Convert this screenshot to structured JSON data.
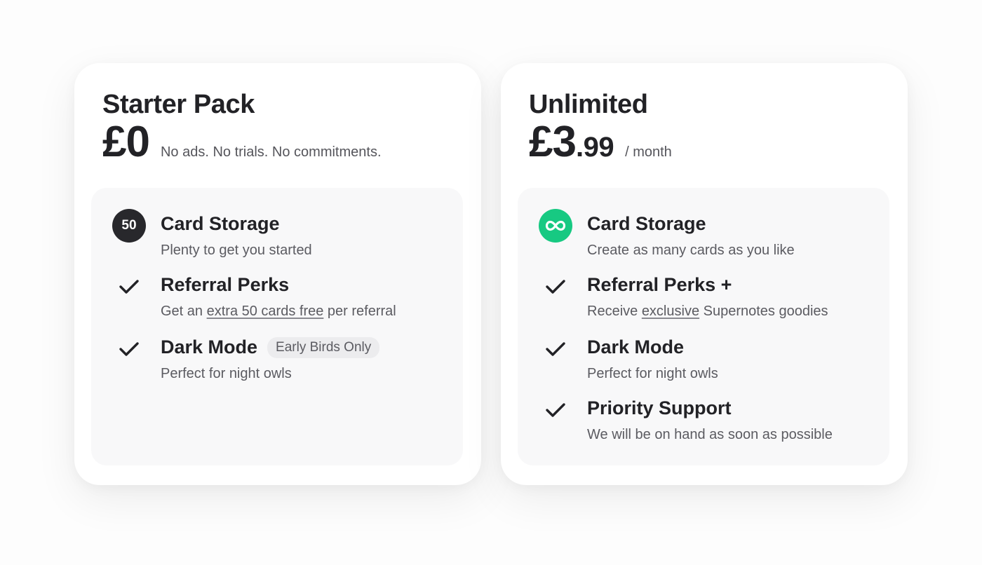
{
  "plans": [
    {
      "title": "Starter Pack",
      "price_main": "£0",
      "price_cents": "",
      "price_note": "No ads. No trials. No commitments.",
      "features": [
        {
          "icon": "50-badge",
          "badge_text": "50",
          "title": "Card Storage",
          "desc_parts": [
            "Plenty to get you started"
          ]
        },
        {
          "icon": "check-icon",
          "title": "Referral Perks",
          "desc_parts": [
            "Get an ",
            "extra 50 cards free",
            " per referral"
          ]
        },
        {
          "icon": "check-icon",
          "title": "Dark Mode",
          "pill": "Early Birds Only",
          "desc_parts": [
            "Perfect for night owls"
          ]
        }
      ]
    },
    {
      "title": "Unlimited",
      "price_main": "£3",
      "price_cents": ".99",
      "price_note": "/ month",
      "features": [
        {
          "icon": "infinity-icon",
          "title": "Card Storage",
          "desc_parts": [
            "Create as many cards as you like"
          ]
        },
        {
          "icon": "check-icon",
          "title": "Referral Perks +",
          "desc_parts": [
            "Receive ",
            "exclusive",
            " Supernotes goodies"
          ]
        },
        {
          "icon": "check-icon",
          "title": "Dark Mode",
          "desc_parts": [
            "Perfect for night owls"
          ]
        },
        {
          "icon": "check-icon",
          "title": "Priority Support",
          "desc_parts": [
            "We will be on hand as soon as possible"
          ]
        }
      ]
    }
  ],
  "colors": {
    "text": "#222226",
    "muted": "#5b5b61",
    "badge_dark": "#28282c",
    "badge_green": "#17c982",
    "panel_bg": "#f8f8f9"
  }
}
